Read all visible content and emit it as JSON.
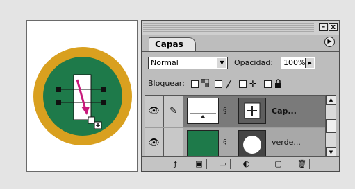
{
  "panel": {
    "tab_label": "Capas",
    "minimize_label": "–",
    "close_label": "x",
    "menu_glyph": "▶",
    "blend_mode": "Normal",
    "opacity_label": "Opacidad:",
    "opacity_value": "100%",
    "lock_label": "Bloquear:",
    "lock_icons": [
      "transparency-lock-icon",
      "image-lock-icon",
      "position-lock-icon",
      "all-lock-icon"
    ]
  },
  "layers": [
    {
      "name": "Cap...",
      "visible": true,
      "thumb": "white-rectangle",
      "mask": "move-cross",
      "selected": true
    },
    {
      "name": "verde...",
      "visible": true,
      "thumb": "green",
      "mask": "white-circle",
      "selected": false
    }
  ],
  "bottom_bar": {
    "icons": [
      "layer-style-icon",
      "mask-icon",
      "new-set-icon",
      "adjustment-layer-icon",
      "new-layer-icon",
      "trash-icon"
    ]
  },
  "colors": {
    "ring_gold": "#d9a01f",
    "badge_green": "#1e7a4a",
    "arrow_magenta": "#c8197b"
  }
}
